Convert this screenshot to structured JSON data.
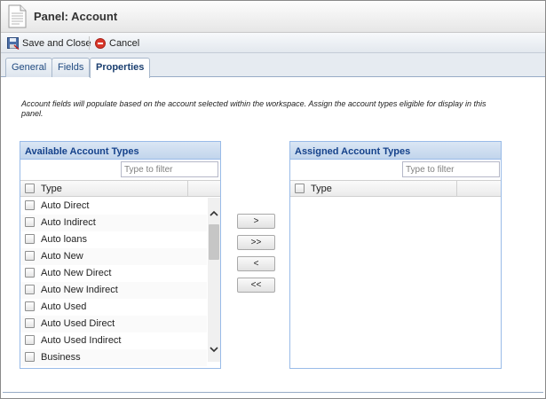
{
  "header": {
    "title": "Panel: Account"
  },
  "toolbar": {
    "save_label": "Save and Close",
    "cancel_label": "Cancel"
  },
  "tabs": [
    {
      "label": "General",
      "active": false
    },
    {
      "label": "Fields",
      "active": false
    },
    {
      "label": "Properties",
      "active": true
    }
  ],
  "description": "Account fields will populate based on the account selected within the workspace. Assign the account types eligible for display in this panel.",
  "available": {
    "title": "Available Account Types",
    "filter_placeholder": "Type to filter",
    "column": "Type",
    "items": [
      "Auto Direct",
      "Auto Indirect",
      "Auto loans",
      "Auto New",
      "Auto New Direct",
      "Auto New Indirect",
      "Auto Used",
      "Auto Used Direct",
      "Auto Used Indirect",
      "Business"
    ]
  },
  "assigned": {
    "title": "Assigned Account Types",
    "filter_placeholder": "Type to filter",
    "column": "Type",
    "items": []
  },
  "transfer": {
    "add_one": ">",
    "add_all": ">>",
    "remove_one": "<",
    "remove_all": "<<"
  },
  "colors": {
    "panel_header_text": "#15428b",
    "panel_border": "#99bbe8",
    "cancel_icon": "#d9372b"
  },
  "icons": {
    "title": "document-icon",
    "save": "save-icon",
    "cancel": "cancel-icon"
  }
}
